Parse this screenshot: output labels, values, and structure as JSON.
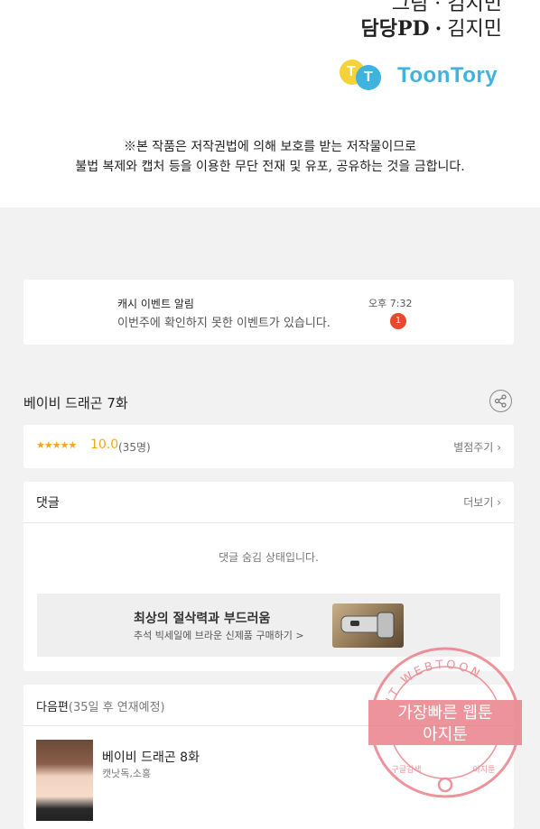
{
  "credits": {
    "cut_line": "그림 · 김지민",
    "role": "담당PD",
    "separator": "·",
    "name": "김지민"
  },
  "logo": {
    "name": "ToonTory",
    "mark_letters": [
      "T",
      "T"
    ]
  },
  "copyright_notice": {
    "line1": "※본 작품은 저작권법에 의해 보호를 받는 저작물이므로",
    "line2": "불법 복제와 캡처 등을 이용한 무단 전재 및 유포, 공유하는 것을 금합니다."
  },
  "cash_event": {
    "title": "캐시 이벤트 알림",
    "message": "이번주에 확인하지 못한 이벤트가 있습니다.",
    "time": "오후 7:32",
    "badge": "1"
  },
  "episode": {
    "title": "베이비 드래곤 7화",
    "share_icon": "share-icon"
  },
  "rating": {
    "stars": "★★★★★",
    "star_value": 5,
    "score": "10.0",
    "count": "(35명)",
    "rate_label": "별점주기",
    "color": "#f2a71b"
  },
  "comments": {
    "title": "댓글",
    "more_label": "더보기",
    "hidden_message": "댓글 숨김 상태입니다."
  },
  "ad": {
    "title": "최상의 절삭력과 부드러움",
    "subtitle": "추석 빅세일에 브라운 신제품 구매하기 >"
  },
  "next": {
    "title": "다음편",
    "schedule": "(35일 후 연재예정)",
    "episode_title": "베이비 드래곤 8화",
    "author": "캣낫독,소홍"
  },
  "watermark": {
    "arc_top": "AGIT WEBTOON",
    "main_line1": "가장빠른 웹툰",
    "main_line2": "아지툰",
    "bottom_left": "구글검색",
    "bottom_right": "아지툰",
    "color": "#e8707a"
  },
  "chevron": "›"
}
